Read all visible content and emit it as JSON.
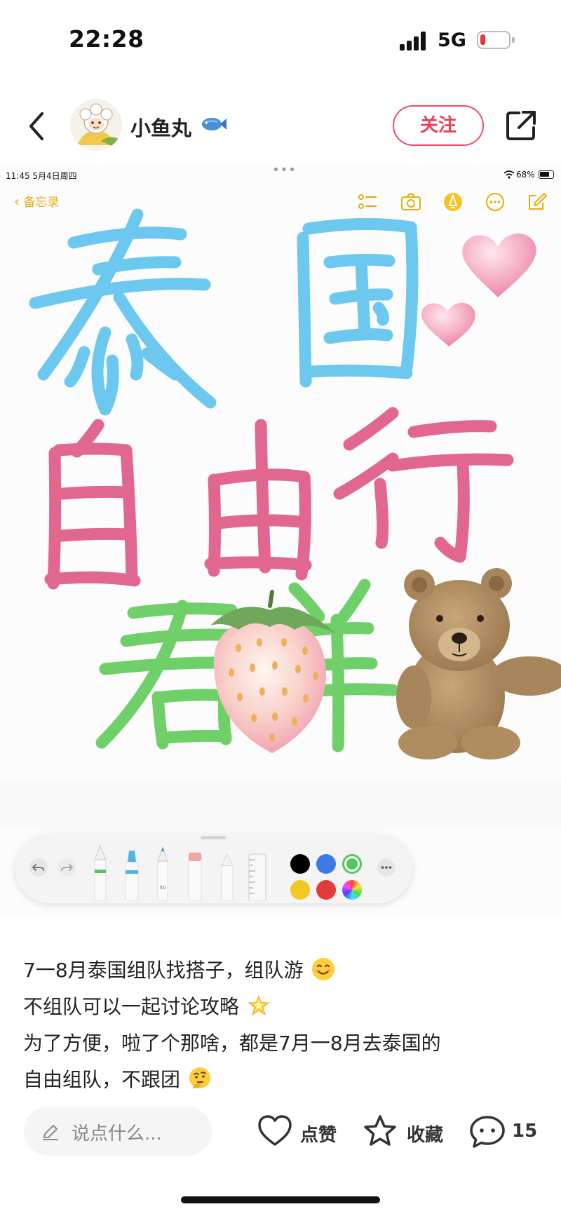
{
  "status_bar": {
    "time": "22:28",
    "network": "5G"
  },
  "header": {
    "author_name": "小鱼丸",
    "follow_label": "关注"
  },
  "note_screenshot": {
    "status": {
      "time_date": "11:45  5月4日周四",
      "battery": "68%"
    },
    "back_label": "备忘录",
    "handwriting_lines": [
      "泰国",
      "自由行",
      "君羊"
    ],
    "colors": {
      "blue": "#6cc8ee",
      "pink": "#e2678e",
      "green": "#6fd06a"
    },
    "palette": {
      "colors": [
        "#000000",
        "#3a7be8",
        "#53c65d",
        "#f5c722",
        "#e23b3b"
      ],
      "pen_size": "50"
    }
  },
  "caption": {
    "lines": [
      "7一8月泰国组队找搭子，组队游",
      "不组队可以一起讨论攻略",
      "为了方便，啦了个那啥，都是7月一8月去泰国的",
      "自由组队，不跟团"
    ]
  },
  "bottom_bar": {
    "comment_placeholder": "说点什么...",
    "like_label": "点赞",
    "collect_label": "收藏",
    "comment_count": "15"
  },
  "accent_color": "#ef3f57"
}
